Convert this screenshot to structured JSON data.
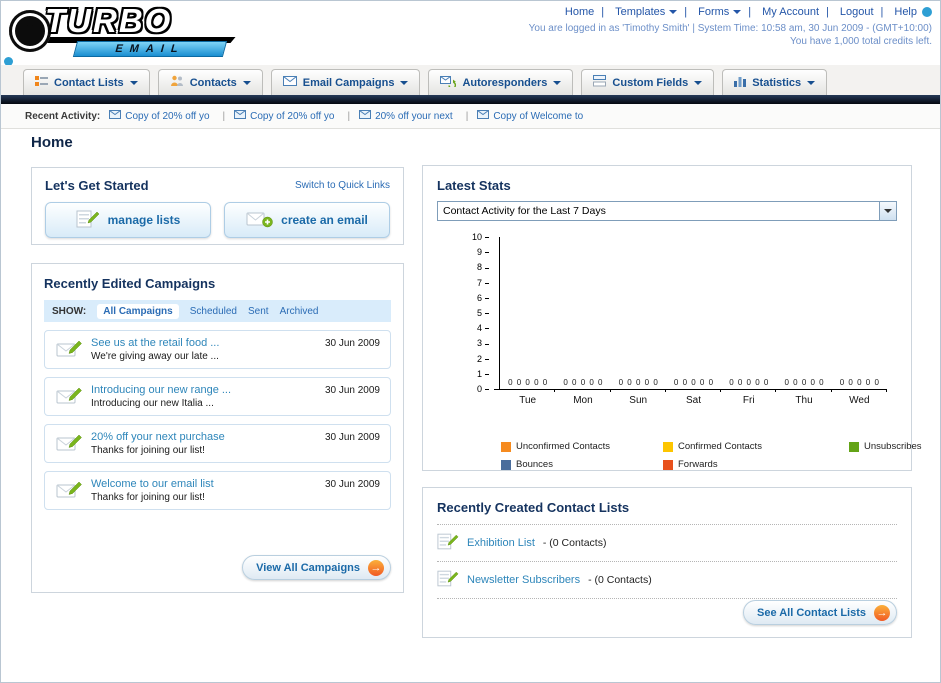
{
  "page": {
    "title": "Home"
  },
  "logo": {
    "line1": "TURBO",
    "line2": "EMAIL"
  },
  "topnav": {
    "items": [
      {
        "label": "Home"
      },
      {
        "label": "Templates"
      },
      {
        "label": "Forms"
      },
      {
        "label": "My Account"
      },
      {
        "label": "Logout"
      },
      {
        "label": "Help"
      }
    ]
  },
  "session": {
    "line1": "You are logged in as 'Timothy Smith' | System Time: 10:58 am, 30 Jun 2009 - (GMT+10:00)",
    "line2": "You have 1,000 total credits left."
  },
  "tabs": {
    "items": [
      {
        "label": "Contact Lists"
      },
      {
        "label": "Contacts"
      },
      {
        "label": "Email Campaigns"
      },
      {
        "label": "Autoresponders"
      },
      {
        "label": "Custom Fields"
      },
      {
        "label": "Statistics"
      }
    ]
  },
  "recent_activity": {
    "label": "Recent Activity:",
    "items": [
      {
        "label": "Copy of 20% off yo"
      },
      {
        "label": "Copy of 20% off yo"
      },
      {
        "label": "20% off your next"
      },
      {
        "label": "Copy of Welcome to"
      }
    ]
  },
  "get_started": {
    "title": "Let's Get Started",
    "switch_link": "Switch to Quick Links",
    "manage_button": "manage lists",
    "create_button": "create an email"
  },
  "campaigns": {
    "title": "Recently Edited Campaigns",
    "show_label": "SHOW:",
    "filters": [
      {
        "label": "All Campaigns",
        "selected": true
      },
      {
        "label": "Scheduled",
        "selected": false
      },
      {
        "label": "Sent",
        "selected": false
      },
      {
        "label": "Archived",
        "selected": false
      }
    ],
    "items": [
      {
        "title": "See us at the retail food ...",
        "subtitle": "We're giving away our late ...",
        "date": "30 Jun 2009"
      },
      {
        "title": "Introducing our new range ...",
        "subtitle": "Introducing our new Italia ...",
        "date": "30 Jun 2009"
      },
      {
        "title": "20% off your next purchase",
        "subtitle": "Thanks for joining our list!",
        "date": "30 Jun 2009"
      },
      {
        "title": "Welcome to our email list",
        "subtitle": "Thanks for joining our list!",
        "date": "30 Jun 2009"
      }
    ],
    "view_all_label": "View All Campaigns"
  },
  "stats": {
    "title": "Latest Stats",
    "selector_value": "Contact Activity for the Last 7 Days"
  },
  "chart_data": {
    "type": "bar",
    "title": "Contact Activity for the Last 7 Days",
    "categories": [
      "Tue",
      "Mon",
      "Sun",
      "Sat",
      "Fri",
      "Thu",
      "Wed"
    ],
    "series": [
      {
        "name": "Unconfirmed Contacts",
        "color": "#f68b1f",
        "values": [
          0,
          0,
          0,
          0,
          0,
          0,
          0
        ]
      },
      {
        "name": "Confirmed Contacts",
        "color": "#fdc500",
        "values": [
          0,
          0,
          0,
          0,
          0,
          0,
          0
        ]
      },
      {
        "name": "Unsubscribes",
        "color": "#64a417",
        "values": [
          0,
          0,
          0,
          0,
          0,
          0,
          0
        ]
      },
      {
        "name": "Bounces",
        "color": "#4a6d9c",
        "values": [
          0,
          0,
          0,
          0,
          0,
          0,
          0
        ]
      },
      {
        "name": "Forwards",
        "color": "#e8511d",
        "values": [
          0,
          0,
          0,
          0,
          0,
          0,
          0
        ]
      }
    ],
    "ylim": [
      0,
      10
    ],
    "grid": false,
    "legend_position": "bottom"
  },
  "contact_lists": {
    "title": "Recently Created Contact Lists",
    "items": [
      {
        "name": "Exhibition List",
        "count": "- (0 Contacts)"
      },
      {
        "name": "Newsletter Subscribers",
        "count": "- (0 Contacts)"
      }
    ],
    "see_all_label": "See All Contact Lists"
  }
}
